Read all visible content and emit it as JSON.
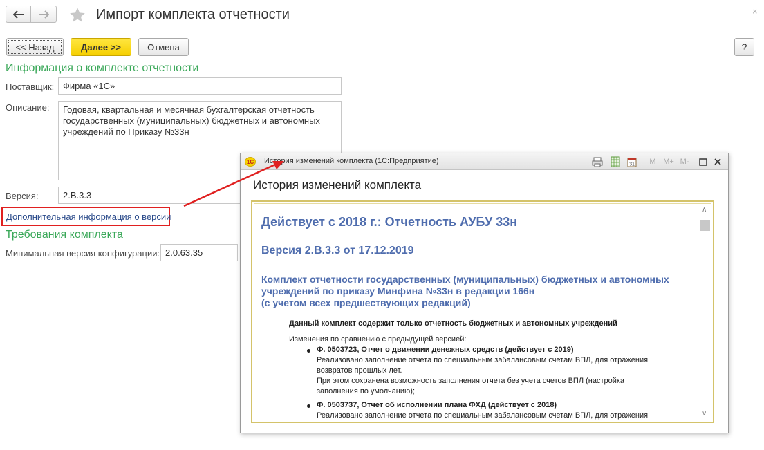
{
  "window": {
    "title": "Импорт комплекта отчетности",
    "close_glyph": "×"
  },
  "toolbar": {
    "back_label": "<< Назад",
    "next_label": "Далее >>",
    "cancel_label": "Отмена",
    "help_label": "?"
  },
  "info": {
    "section_title": "Информация о комплекте отчетности",
    "supplier_label": "Поставщик:",
    "supplier_value": "Фирма «1С»",
    "description_label": "Описание:",
    "description_value": "Годовая, квартальная и месячная бухгалтерская отчетность государственных (муниципальных) бюджетных и автономных учреждений по Приказу №33н",
    "version_label": "Версия:",
    "version_value": "2.В.3.3",
    "more_info_link": "Дополнительная информация о версии"
  },
  "requirements": {
    "section_title": "Требования комплекта",
    "min_version_label": "Минимальная версия конфигурации:",
    "min_version_value": "2.0.63.35"
  },
  "popup": {
    "window_title": "История изменений комплекта  (1С:Предприятие)",
    "logo_text": "1С",
    "heading": "История изменений комплекта",
    "toolbar_m": "M",
    "toolbar_mplus": "M+",
    "toolbar_mminus": "M-",
    "doc": {
      "h1": "Действует с 2018 г.: Отчетность АУБУ 33н",
      "h2": "Версия 2.В.3.3 от 17.12.2019",
      "h3_line1": "Комплект отчетности государственных (муниципальных) бюджетных и автономных",
      "h3_line2": "учреждений по приказу Минфина №33н в редакции 166н",
      "h3_line3": "(с учетом всех предшествующих редакций)",
      "note": "Данный комплект содержит только отчетность бюджетных и автономных учреждений",
      "changes_intro": "Изменения по сравнению с предыдущей версией:",
      "items": [
        {
          "title": "Ф. 0503723, Отчет о движении денежных средств (действует с 2019)",
          "line1": "Реализовано заполнение отчета по специальным забалансовым счетам ВПЛ, для отражения",
          "line2": "возвратов прошлых лет.",
          "line3": "При этом сохранена возможность заполнения отчета без учета счетов ВПЛ (настройка",
          "line4": "заполнения по умолчанию);"
        },
        {
          "title": "Ф. 0503737, Отчет об исполнении плана ФХД (действует с 2018)",
          "line1": "Реализовано заполнение отчета по специальным забалансовым счетам ВПЛ, для отражения"
        }
      ]
    }
  },
  "colors": {
    "section_green": "#3aa859",
    "doc_blue": "#4f6dae",
    "next_button_yellow": "#f5cf00",
    "highlight_red": "#e02020"
  }
}
